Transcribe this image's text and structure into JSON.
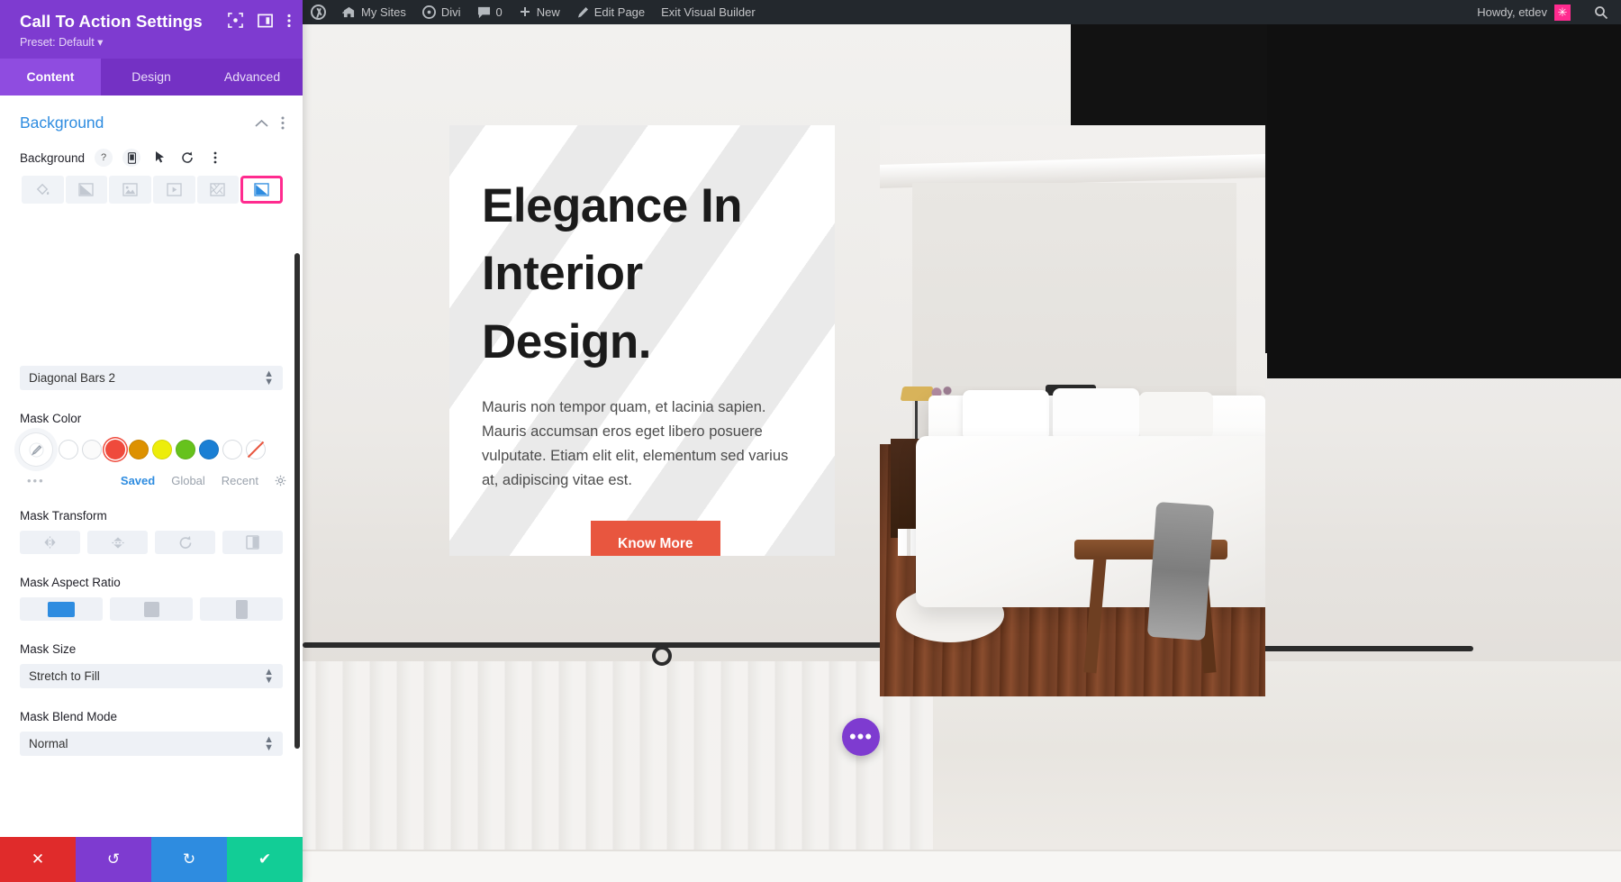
{
  "admin_bar": {
    "items": [
      {
        "icon": "wordpress-logo-icon",
        "label": ""
      },
      {
        "icon": "sites-icon",
        "label": "My Sites"
      },
      {
        "icon": "divi-icon",
        "label": "Divi"
      },
      {
        "icon": "comment-icon",
        "label": "0"
      },
      {
        "icon": "plus-icon",
        "label": "New"
      },
      {
        "icon": "pencil-icon",
        "label": "Edit Page"
      },
      {
        "icon": "",
        "label": "Exit Visual Builder"
      }
    ],
    "howdy": "Howdy, etdev",
    "avatar_glyph": "✳",
    "search_icon": "search-icon"
  },
  "panel": {
    "title": "Call To Action Settings",
    "preset": "Preset: Default",
    "preset_caret": "▾",
    "header_icons": [
      {
        "name": "focus-target-icon"
      },
      {
        "name": "layout-columns-icon"
      },
      {
        "name": "kebab-menu-icon"
      }
    ],
    "tabs": [
      {
        "label": "Content",
        "active": true
      },
      {
        "label": "Design",
        "active": false
      },
      {
        "label": "Advanced",
        "active": false
      }
    ],
    "section": {
      "title": "Background",
      "collapse_icon": "chevron-up-icon",
      "more_icon": "kebab-menu-icon"
    },
    "field": {
      "label": "Background",
      "controls": [
        {
          "name": "help-icon",
          "glyph": "?"
        },
        {
          "name": "responsive-mobile-icon",
          "glyph": ""
        },
        {
          "name": "hover-cursor-icon",
          "glyph": ""
        },
        {
          "name": "reset-icon",
          "glyph": ""
        },
        {
          "name": "kebab-menu-icon",
          "glyph": ""
        }
      ],
      "bg_tabs": [
        {
          "name": "background-color-tab",
          "icon": "paint-bucket-icon",
          "selected": false
        },
        {
          "name": "background-gradient-tab",
          "icon": "gradient-icon",
          "selected": false
        },
        {
          "name": "background-image-tab",
          "icon": "image-icon",
          "selected": false
        },
        {
          "name": "background-video-tab",
          "icon": "video-icon",
          "selected": false
        },
        {
          "name": "background-pattern-tab",
          "icon": "pattern-icon",
          "selected": false
        },
        {
          "name": "background-mask-tab",
          "icon": "mask-icon",
          "selected": true
        }
      ]
    },
    "mask_style": {
      "label": "",
      "value": "Diagonal Bars 2"
    },
    "mask_color": {
      "label": "Mask Color",
      "picker_icon": "eyedropper-icon",
      "swatches": [
        {
          "name": "swatch-white-1",
          "color": "#ffffff"
        },
        {
          "name": "swatch-white-2",
          "color": "#fdfdfd"
        },
        {
          "name": "swatch-red",
          "color": "#ef4a3c"
        },
        {
          "name": "swatch-orange",
          "color": "#dd9100"
        },
        {
          "name": "swatch-yellow",
          "color": "#eded0a"
        },
        {
          "name": "swatch-green",
          "color": "#66c21c"
        },
        {
          "name": "swatch-blue",
          "color": "#1a7fd4"
        },
        {
          "name": "swatch-white-3",
          "color": "#ffffff"
        },
        {
          "name": "swatch-none",
          "color": "transparent"
        }
      ],
      "more_dots": "•••",
      "source_tabs": [
        {
          "label": "Saved",
          "active": true
        },
        {
          "label": "Global",
          "active": false
        },
        {
          "label": "Recent",
          "active": false
        }
      ],
      "settings_icon": "gear-icon"
    },
    "mask_transform": {
      "label": "Mask Transform",
      "buttons": [
        {
          "name": "flip-horizontal-button",
          "icon": "flip-horizontal-icon"
        },
        {
          "name": "flip-vertical-button",
          "icon": "flip-vertical-icon"
        },
        {
          "name": "rotate-button",
          "icon": "rotate-icon"
        },
        {
          "name": "invert-button",
          "icon": "invert-icon"
        }
      ]
    },
    "mask_aspect_ratio": {
      "label": "Mask Aspect Ratio",
      "options": [
        {
          "name": "aspect-landscape",
          "selected": true
        },
        {
          "name": "aspect-square",
          "selected": false
        },
        {
          "name": "aspect-portrait",
          "selected": false
        }
      ]
    },
    "mask_size": {
      "label": "Mask Size",
      "value": "Stretch to Fill"
    },
    "mask_blend_mode": {
      "label": "Mask Blend Mode",
      "value": "Normal"
    },
    "footer": [
      {
        "name": "cancel-button",
        "glyph": "✕",
        "color": "#e02b2b"
      },
      {
        "name": "undo-button",
        "glyph": "↺",
        "color": "#7e3bd0"
      },
      {
        "name": "redo-button",
        "glyph": "↻",
        "color": "#2e8ce0"
      },
      {
        "name": "save-button",
        "glyph": "✔",
        "color": "#12cd96"
      }
    ]
  },
  "preview": {
    "heading": "Elegance In\nInterior\nDesign.",
    "body": "Mauris non tempor quam, et lacinia sapien. Mauris accumsan eros eget libero posuere vulputate. Etiam elit elit, elementum sed varius at, adipiscing vitae est.",
    "button": "Know More",
    "fab_glyph": "•••"
  }
}
